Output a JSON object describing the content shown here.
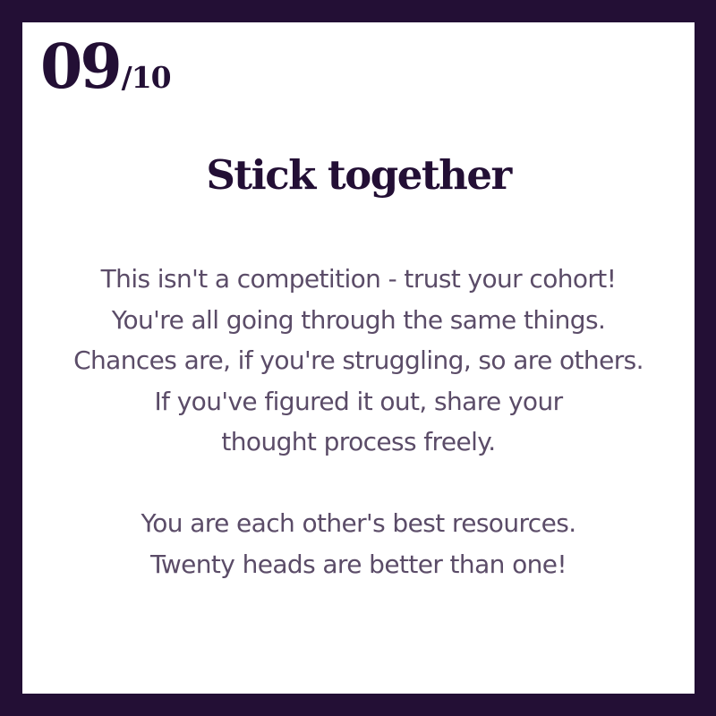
{
  "counter": {
    "current": "09",
    "total": "/10"
  },
  "title": "Stick together",
  "paragraph1": [
    "This isn't a competition - trust your cohort!",
    "You're all going through the same things.",
    "Chances are, if you're struggling, so are others.",
    "If you've figured it out, share your",
    "thought process freely."
  ],
  "paragraph2": [
    "You are each other's best resources.",
    "Twenty heads are better than one!"
  ],
  "colors": {
    "border": "#230f35",
    "heading": "#230f35",
    "body_text": "#5b4c68",
    "background": "#ffffff"
  }
}
